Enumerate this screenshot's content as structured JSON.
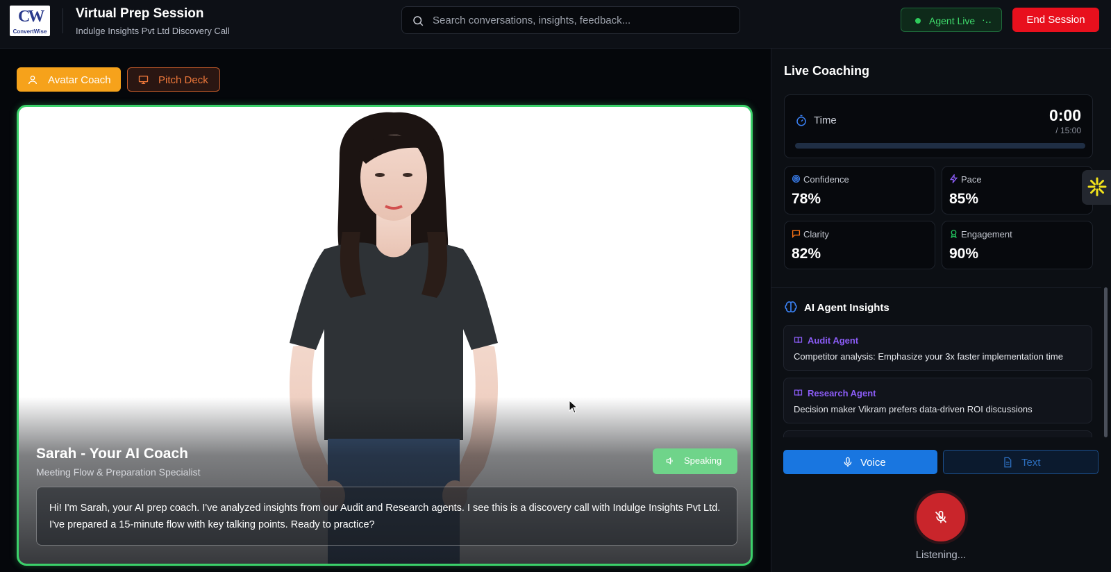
{
  "header": {
    "logo": {
      "mark": "CW",
      "word": "ConvertWise"
    },
    "title": "Virtual Prep Session",
    "subtitle": "Indulge Insights Pvt Ltd Discovery Call",
    "search_placeholder": "Search conversations, insights, feedback...",
    "agent_status": {
      "label": "Agent Live",
      "dots": "·‥",
      "color": "#2ecc5b"
    },
    "end_session_label": "End Session"
  },
  "mode_buttons": [
    {
      "label": "Avatar Coach",
      "icon": "user-icon",
      "active": true
    },
    {
      "label": "Pitch Deck",
      "icon": "presentation-icon",
      "active": false
    }
  ],
  "avatar": {
    "name": "Sarah - Your AI Coach",
    "role": "Meeting Flow & Preparation Specialist",
    "status_label": "Speaking",
    "message": "Hi! I'm Sarah, your AI prep coach. I've analyzed insights from our Audit and Research agents. I see this is a discovery call with Indulge Insights Pvt Ltd. I've prepared a 15-minute flow with key talking points. Ready to practice?"
  },
  "coaching": {
    "title": "Live Coaching",
    "time": {
      "label": "Time",
      "value": "0:00",
      "max": "/ 15:00",
      "progress": 0
    },
    "metrics": [
      {
        "label": "Confidence",
        "value": "78%",
        "icon": "target-icon",
        "color": "#3b82f6"
      },
      {
        "label": "Pace",
        "value": "85%",
        "icon": "lightning-icon",
        "color": "#8b5cf6"
      },
      {
        "label": "Clarity",
        "value": "82%",
        "icon": "message-square-icon",
        "color": "#f97316"
      },
      {
        "label": "Engagement",
        "value": "90%",
        "icon": "award-icon",
        "color": "#22c55e"
      }
    ]
  },
  "insights": {
    "title": "AI Agent Insights",
    "items": [
      {
        "agent": "Audit Agent",
        "message": "Competitor analysis: Emphasize your 3x faster implementation time"
      },
      {
        "agent": "Research Agent",
        "message": "Decision maker Vikram prefers data-driven ROI discussions"
      },
      {
        "agent": "",
        "message": ""
      }
    ]
  },
  "input_modes": {
    "voice_label": "Voice",
    "text_label": "Text",
    "active": "Voice"
  },
  "mic": {
    "status": "Listening..."
  },
  "colors": {
    "accent_green": "#3bd16a",
    "accent_orange": "#f6a21b",
    "accent_blue": "#1976e0",
    "danger": "#e8101d",
    "agent_purple": "#8b5cf6"
  }
}
